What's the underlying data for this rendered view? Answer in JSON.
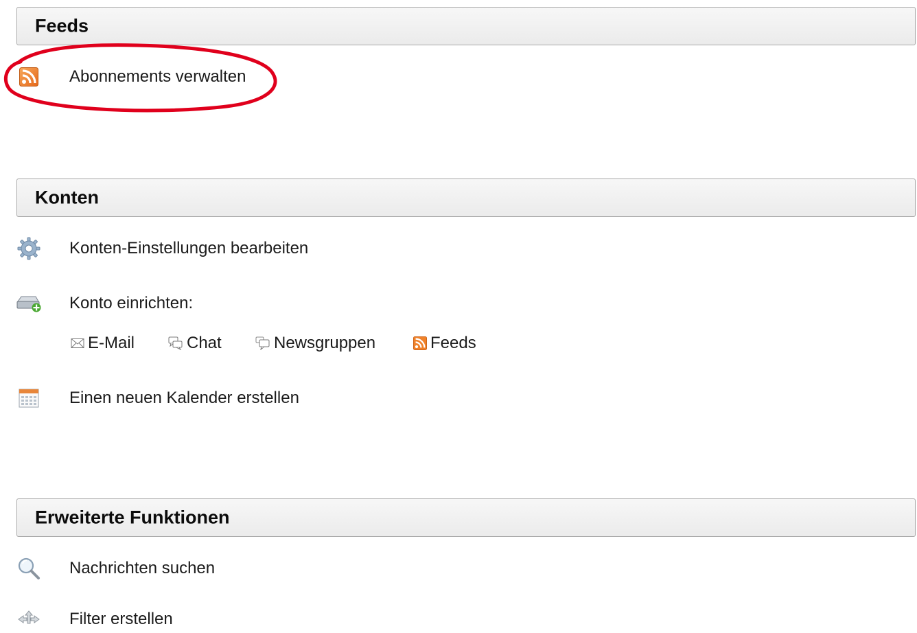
{
  "colors": {
    "highlight": "#e0001c",
    "feed_orange": "#f0822a",
    "header_border": "#a8a8a8"
  },
  "sections": {
    "feeds": {
      "title": "Feeds",
      "items": [
        {
          "label": "Abonnements verwalten",
          "icon": "rss-feed-icon"
        }
      ]
    },
    "accounts": {
      "title": "Konten",
      "items": [
        {
          "label": "Konten-Einstellungen bearbeiten",
          "icon": "gear-icon"
        },
        {
          "label": "Konto einrichten:",
          "icon": "add-account-icon"
        },
        {
          "label": "Einen neuen Kalender erstellen",
          "icon": "calendar-icon"
        }
      ],
      "setup_links": [
        {
          "label": "E-Mail",
          "icon": "envelope-icon"
        },
        {
          "label": "Chat",
          "icon": "chat-bubbles-icon"
        },
        {
          "label": "Newsgruppen",
          "icon": "newsgroup-bubbles-icon"
        },
        {
          "label": "Feeds",
          "icon": "rss-feed-icon"
        }
      ]
    },
    "advanced": {
      "title": "Erweiterte Funktionen",
      "items": [
        {
          "label": "Nachrichten suchen",
          "icon": "magnifier-icon"
        },
        {
          "label": "Filter erstellen",
          "icon": "filter-arrows-icon"
        }
      ]
    }
  }
}
